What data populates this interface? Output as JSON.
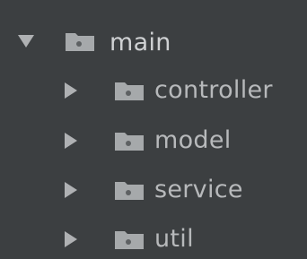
{
  "project_tree": {
    "root": {
      "label": "main",
      "expanded": true,
      "icon": "folder-icon"
    },
    "children": [
      {
        "label": "controller",
        "expanded": false,
        "icon": "folder-icon"
      },
      {
        "label": "model",
        "expanded": false,
        "icon": "folder-icon"
      },
      {
        "label": "service",
        "expanded": false,
        "icon": "folder-icon"
      },
      {
        "label": "util",
        "expanded": false,
        "icon": "folder-icon"
      }
    ]
  },
  "colors": {
    "background": "#3c3f41",
    "arrow": "#afb1b3",
    "folder_fill": "#a6a9ab",
    "text": "#b7b9bb"
  }
}
